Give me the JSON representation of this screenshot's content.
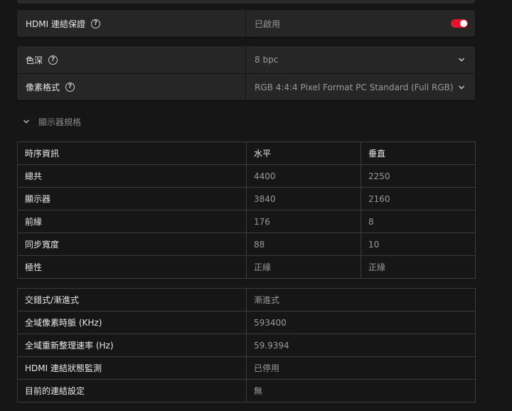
{
  "hdmi_link": {
    "label": "HDMI 連結保證",
    "value": "已啟用",
    "enabled": true,
    "accent": "#e8132c"
  },
  "color_depth": {
    "label": "色深",
    "value": "8 bpc"
  },
  "pixel_format": {
    "label": "像素格式",
    "value": "RGB 4:4:4 Pixel Format PC Standard (Full RGB)"
  },
  "display_specs": {
    "title": "顯示器規格"
  },
  "timing_table": {
    "headers": [
      "時序資訊",
      "水平",
      "垂直"
    ],
    "rows": [
      [
        "總共",
        "4400",
        "2250"
      ],
      [
        "顯示器",
        "3840",
        "2160"
      ],
      [
        "前緣",
        "176",
        "8"
      ],
      [
        "同步寬度",
        "88",
        "10"
      ],
      [
        "極性",
        "正緣",
        "正緣"
      ]
    ]
  },
  "info_table": {
    "rows": [
      [
        "交錯式/漸進式",
        "漸進式"
      ],
      [
        "全域像素時脈 (KHz)",
        "593400"
      ],
      [
        "全域重新整理速率 (Hz)",
        "59.9394"
      ],
      [
        "HDMI 連結狀態監測",
        "已停用"
      ],
      [
        "目前的連結設定",
        "無"
      ]
    ]
  },
  "icons": {
    "help": "question-circle-icon",
    "dropdown": "chevron-down-icon",
    "collapse": "chevron-down-icon"
  }
}
